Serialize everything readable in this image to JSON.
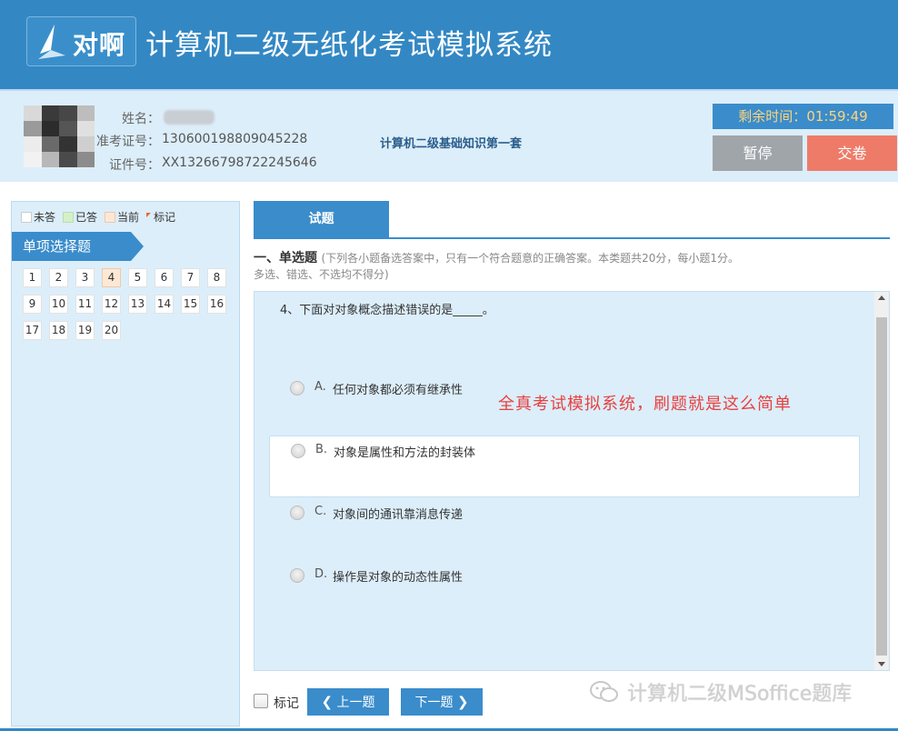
{
  "header": {
    "logo_text": "对啊",
    "title": "计算机二级无纸化考试模拟系统"
  },
  "candidate": {
    "name_label": "姓名：",
    "admission_label": "准考证号：",
    "admission_number": "130600198809045228",
    "id_label": "证件号：",
    "id_number": "XX13266798722245646",
    "exam_set": "计算机二级基础知识第一套"
  },
  "timer": {
    "label": "剩余时间：",
    "value": "01:59:49"
  },
  "actions": {
    "pause": "暂停",
    "submit": "交卷"
  },
  "legend": {
    "unanswered": "未答",
    "answered": "已答",
    "current": "当前",
    "flagged": "标记"
  },
  "section_nav": {
    "title": "单项选择题",
    "questions": [
      "1",
      "2",
      "3",
      "4",
      "5",
      "6",
      "7",
      "8",
      "9",
      "10",
      "11",
      "12",
      "13",
      "14",
      "15",
      "16",
      "17",
      "18",
      "19",
      "20"
    ],
    "current": "4"
  },
  "tabs": {
    "active": "试题"
  },
  "section": {
    "heading": "一、单选题",
    "note_line1": "(下列各小题备选答案中，只有一个符合题意的正确答案。本类题共20分，每小题1分。",
    "note_line2": "多选、错选、不选均不得分)"
  },
  "question": {
    "text": "4、下面对对象概念描述错误的是_____。",
    "options": [
      {
        "letter": "A.",
        "text": "任何对象都必须有继承性"
      },
      {
        "letter": "B.",
        "text": "对象是属性和方法的封装体"
      },
      {
        "letter": "C.",
        "text": "对象间的通讯靠消息传递"
      },
      {
        "letter": "D.",
        "text": "操作是对象的动态性属性"
      }
    ]
  },
  "promo": "全真考试模拟系统，刷题就是这么简单",
  "bottom": {
    "mark_label": "标记",
    "prev": "上一题",
    "next": "下一题",
    "prev_arrow": "❮",
    "next_arrow": "❯"
  },
  "watermark": "计算机二级MSoffice题库",
  "colors": {
    "primary": "#3388c4",
    "panel_bg": "#dceefa",
    "submit": "#ee7b68",
    "pause": "#a0a5aa",
    "promo": "#e84040"
  }
}
